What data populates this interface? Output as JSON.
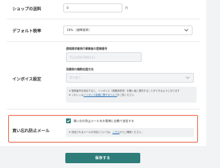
{
  "shipping": {
    "label": "ショップの送料",
    "value": "0",
    "unit": "円"
  },
  "tax": {
    "label": "デフォルト税率",
    "selected": "10% （標準税率）"
  },
  "invoice": {
    "label": "インボイス設定",
    "reg_number_label": "適格請求書発行事業者の登録番号",
    "reg_number_placeholder": "T1234567890123",
    "tax_method_label": "消費税の端数処理方法",
    "tax_method_selected": "切り捨て",
    "note_line1": "※ 登録番号を設定すると、インボイス（適格請求書）を購入者に提供することができるようになります",
    "note_line2_pre": "※ くわしくは",
    "note_line2_link": "インボイス制度に関するヘルプ",
    "note_line2_post": "をご覧ください"
  },
  "forgot_buy": {
    "label": "買い忘れ防止メール",
    "checkbox_label": "買い忘れ防止メールをお客様に自動で送信する",
    "checked": true,
    "note_pre": "※ 送信されるメールの内容については、",
    "note_link": "こちら",
    "note_post": "からご確認ください。"
  },
  "save_button": "保存する",
  "colors": {
    "accent": "#2e7d7a",
    "highlight": "#e85a3a",
    "link": "#2a6fb5"
  }
}
